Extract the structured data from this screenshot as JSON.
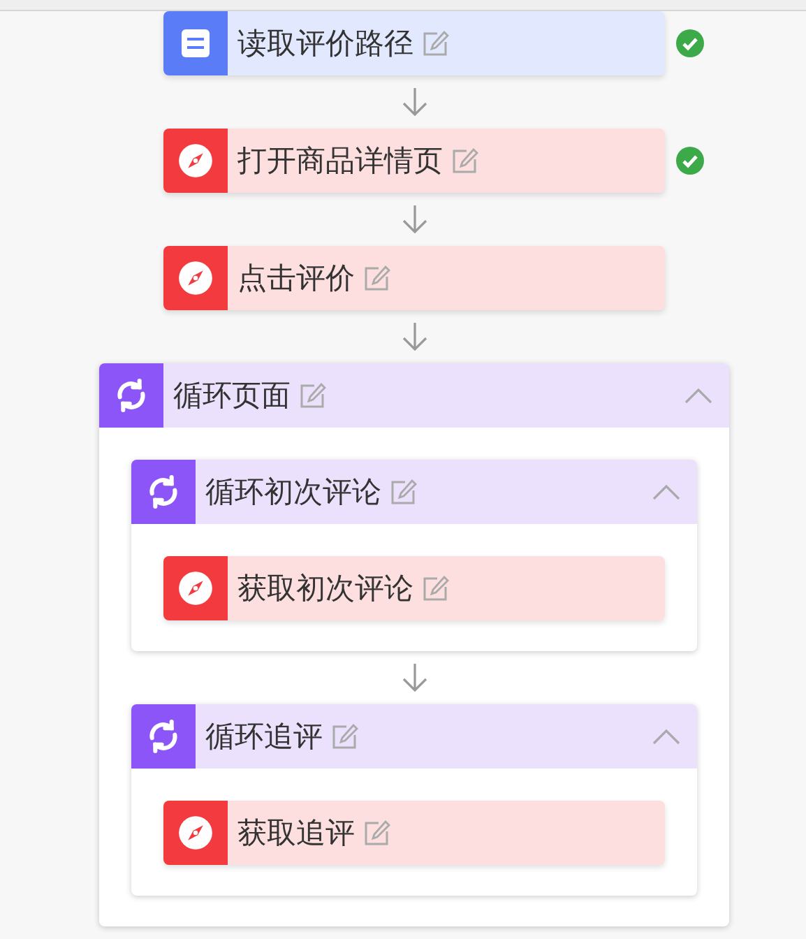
{
  "steps": [
    {
      "kind": "read",
      "label": "读取评价路径",
      "done": true
    },
    {
      "kind": "browser",
      "label": "打开商品详情页",
      "done": true
    },
    {
      "kind": "browser",
      "label": "点击评价",
      "done": false
    },
    {
      "kind": "loop",
      "label": "循环页面",
      "done": false,
      "expanded": true,
      "children": [
        {
          "kind": "loop",
          "label": "循环初次评论",
          "done": false,
          "expanded": true,
          "children": [
            {
              "kind": "browser",
              "label": "获取初次评论",
              "done": false
            }
          ]
        },
        {
          "kind": "loop",
          "label": "循环追评",
          "done": false,
          "expanded": true,
          "children": [
            {
              "kind": "browser",
              "label": "获取追评",
              "done": false
            }
          ]
        }
      ]
    }
  ]
}
